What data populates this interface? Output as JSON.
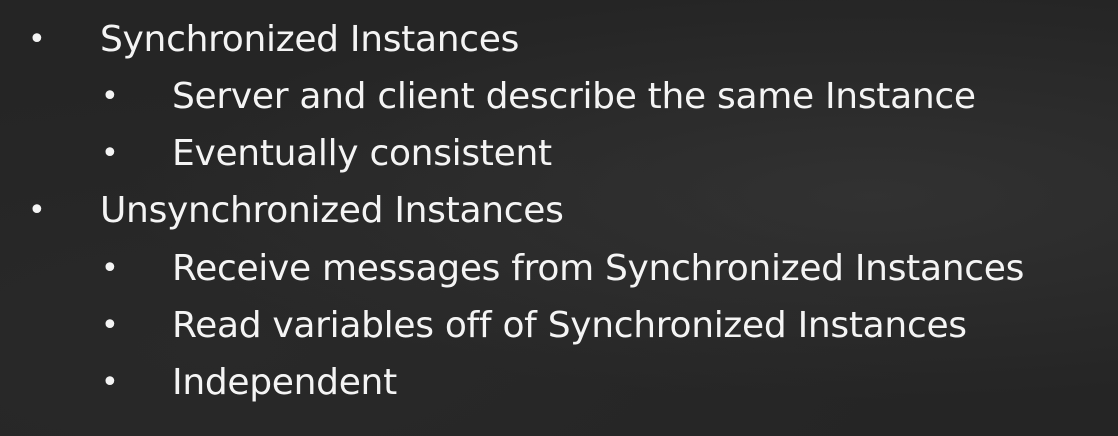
{
  "bullet_glyph": "•",
  "list": {
    "items": [
      {
        "text": "Synchronized Instances"
      },
      {
        "text": "Server and client describe the same Instance"
      },
      {
        "text": "Eventually consistent"
      },
      {
        "text": "Unsynchronized Instances"
      },
      {
        "text": "Receive messages from Synchronized Instances"
      },
      {
        "text": "Read variables off of Synchronized Instances"
      },
      {
        "text": "Independent"
      }
    ]
  },
  "colors": {
    "background": "#252525",
    "text": "#f4f4f4"
  }
}
